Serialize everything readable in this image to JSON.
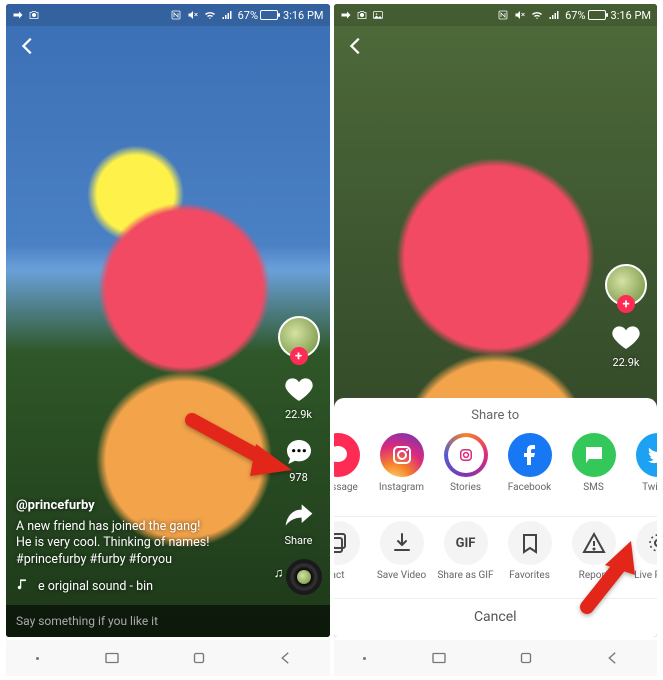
{
  "status": {
    "battery_pct": "67%",
    "time": "3:16 PM"
  },
  "left": {
    "rail": {
      "likes": "22.9k",
      "comments": "978",
      "share_label": "Share"
    },
    "caption": {
      "username": "@princefurby",
      "line1": "A new friend has joined the gang!",
      "line2": "He is very cool. Thinking of names!",
      "hashtags": "#princefurby #furby #foryou",
      "music": "e   original sound - bin"
    },
    "comment_placeholder": "Say something if you like it"
  },
  "right": {
    "rail": {
      "likes": "22.9k"
    },
    "sheet": {
      "title": "Share to",
      "row1": [
        {
          "id": "message",
          "label": "Message",
          "color": "#fe2c55",
          "icon": "chat"
        },
        {
          "id": "instagram",
          "label": "Instagram",
          "color": "ig",
          "icon": "instagram"
        },
        {
          "id": "stories",
          "label": "Stories",
          "color": "igstory",
          "icon": "stories"
        },
        {
          "id": "facebook",
          "label": "Facebook",
          "color": "#1877f2",
          "icon": "facebook"
        },
        {
          "id": "sms",
          "label": "SMS",
          "color": "#34c759",
          "icon": "sms"
        },
        {
          "id": "twitter",
          "label": "Twitter",
          "color": "#1da1f2",
          "icon": "twitter"
        }
      ],
      "row2": [
        {
          "id": "act",
          "label": "act",
          "icon": "copy"
        },
        {
          "id": "save",
          "label": "Save Video",
          "icon": "download"
        },
        {
          "id": "gif",
          "label": "Share as GIF",
          "icon": "gif"
        },
        {
          "id": "favorites",
          "label": "Favorites",
          "icon": "bookmark"
        },
        {
          "id": "report",
          "label": "Report",
          "icon": "alert"
        },
        {
          "id": "livephoto",
          "label": "Live Photo",
          "icon": "livephoto"
        }
      ],
      "cancel": "Cancel"
    }
  }
}
